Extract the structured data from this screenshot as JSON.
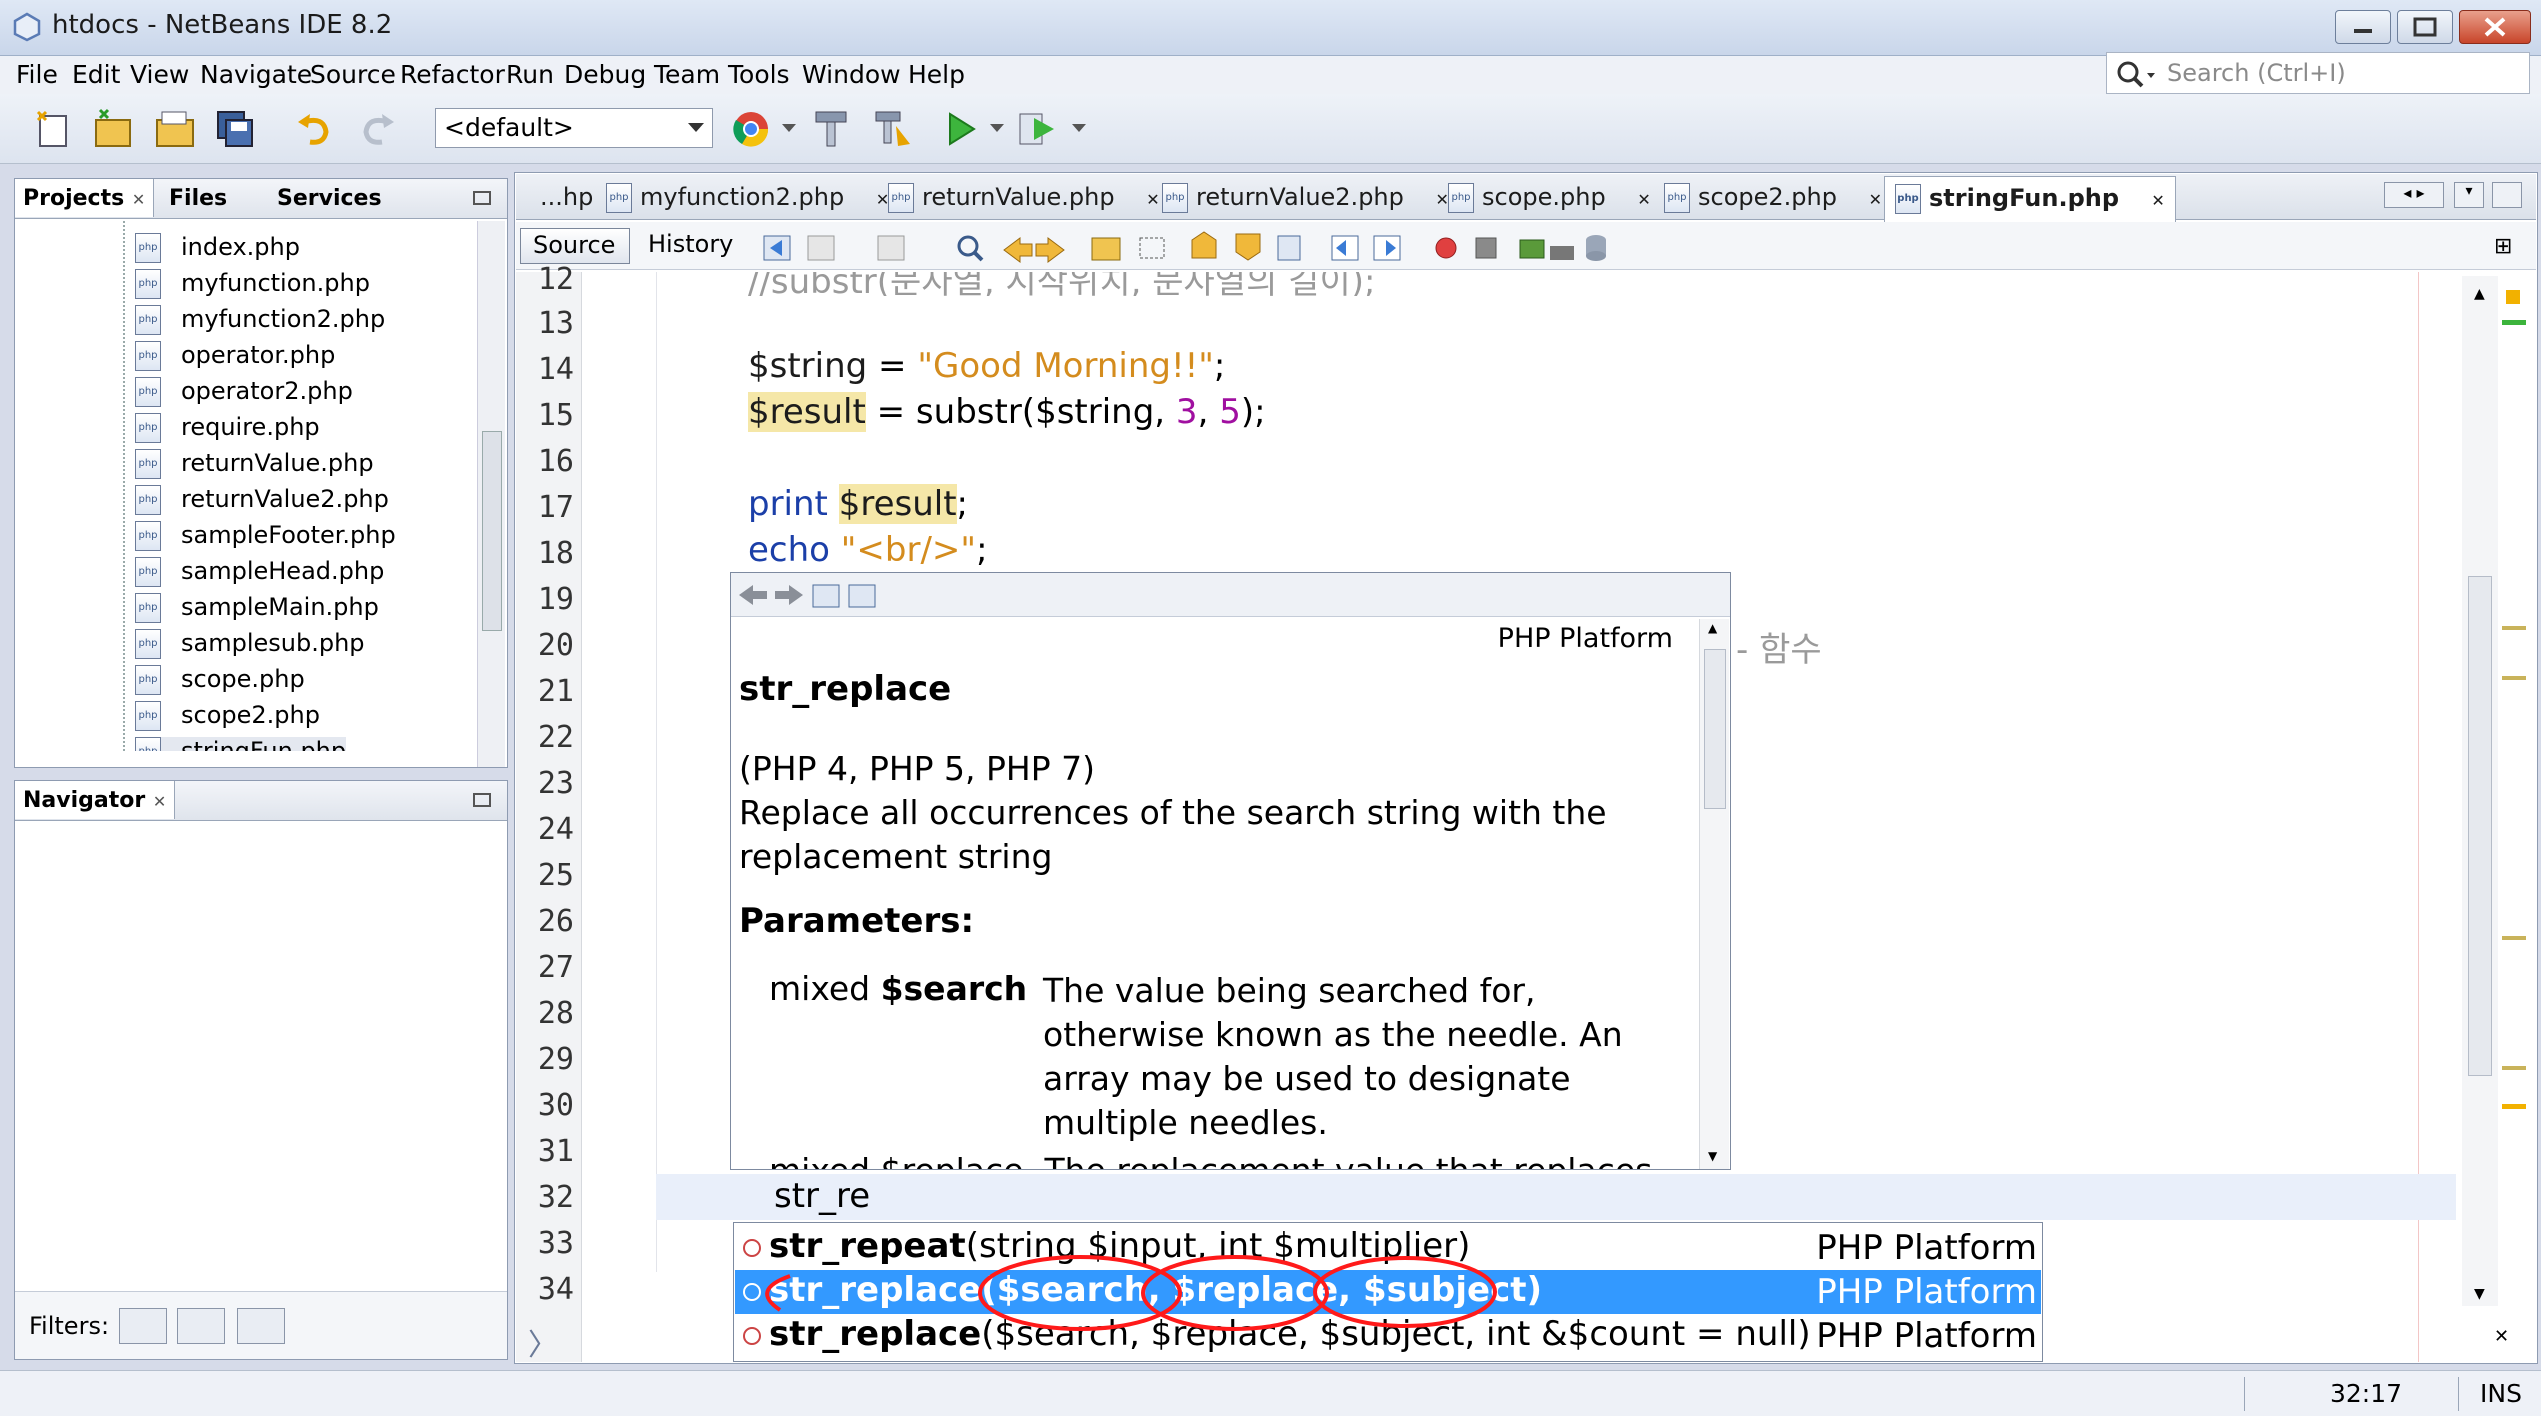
{
  "window": {
    "title": "htdocs - NetBeans IDE 8.2"
  },
  "menu": [
    "File",
    "Edit",
    "View",
    "Navigate",
    "Source",
    "Refactor",
    "Run",
    "Debug",
    "Team",
    "Tools",
    "Window",
    "Help"
  ],
  "search": {
    "placeholder": "Search (Ctrl+I)"
  },
  "toolbar": {
    "config": "<default>"
  },
  "projects_panel": {
    "tabs": [
      "Projects",
      "Files",
      "Services"
    ],
    "files": [
      "index.php",
      "myfunction.php",
      "myfunction2.php",
      "operator.php",
      "operator2.php",
      "require.php",
      "returnValue.php",
      "returnValue2.php",
      "sampleFooter.php",
      "sampleHead.php",
      "sampleMain.php",
      "samplesub.php",
      "scope.php",
      "scope2.php",
      "stringFun.php"
    ]
  },
  "navigator": {
    "title": "Navigator",
    "filters_label": "Filters:"
  },
  "editor": {
    "tabs": [
      "...hp",
      "myfunction2.php",
      "returnValue.php",
      "returnValue2.php",
      "scope.php",
      "scope2.php",
      "stringFun.php"
    ],
    "subtabs": [
      "Source",
      "History"
    ],
    "line_numbers": [
      "12",
      "13",
      "14",
      "15",
      "16",
      "17",
      "18",
      "19",
      "20",
      "21",
      "22",
      "23",
      "24",
      "25",
      "26",
      "27",
      "28",
      "29",
      "30",
      "31",
      "32",
      "33",
      "34"
    ],
    "code": {
      "line12": "//substr(문자열, 시작위치, 문자열의 길이);",
      "line14_var": "$string",
      "line14_eq": " = ",
      "line14_str": "\"Good Morning!!\"",
      "line14_end": ";",
      "line15_var": "$result",
      "line15_mid": " = substr($string, ",
      "line15_n1": "3",
      "line15_comma": ", ",
      "line15_n2": "5",
      "line15_end": ");",
      "line17_kw": "print ",
      "line17_var": "$result",
      "line17_end": ";",
      "line18_kw": "echo ",
      "line18_str": "\"<br/>\"",
      "line18_end": ";",
      "line20_tail": "- 함수",
      "line32": "str_re"
    }
  },
  "doc_popup": {
    "source": "PHP Platform",
    "function": "str_replace",
    "versions": "(PHP 4, PHP 5, PHP 7)",
    "description_1": "Replace all occurrences of the search string with the",
    "description_2": "replacement string",
    "params_heading": "Parameters:",
    "param_type": "mixed ",
    "param_name": "$search",
    "param_desc": [
      "The value being searched for,",
      "otherwise known as the needle. An",
      "array may be used to designate",
      "multiple needles."
    ],
    "param2_cut": "mixed $replace  The replacement value that replaces"
  },
  "completion": [
    {
      "name": "str_repeat",
      "args": "(string $input, int $multiplier)",
      "platform": "PHP Platform",
      "selected": false
    },
    {
      "name": "str_replace",
      "args": "($search, $replace, $subject)",
      "platform": "PHP Platform",
      "selected": true
    },
    {
      "name": "str_replace",
      "args": "($search, $replace, $subject, int &$count = null)",
      "platform": "PHP Platform",
      "selected": false
    }
  ],
  "status": {
    "position": "32:17",
    "mode": "INS"
  },
  "colors": {
    "selection": "#3399ff",
    "annotation": "#ff1a1a"
  }
}
